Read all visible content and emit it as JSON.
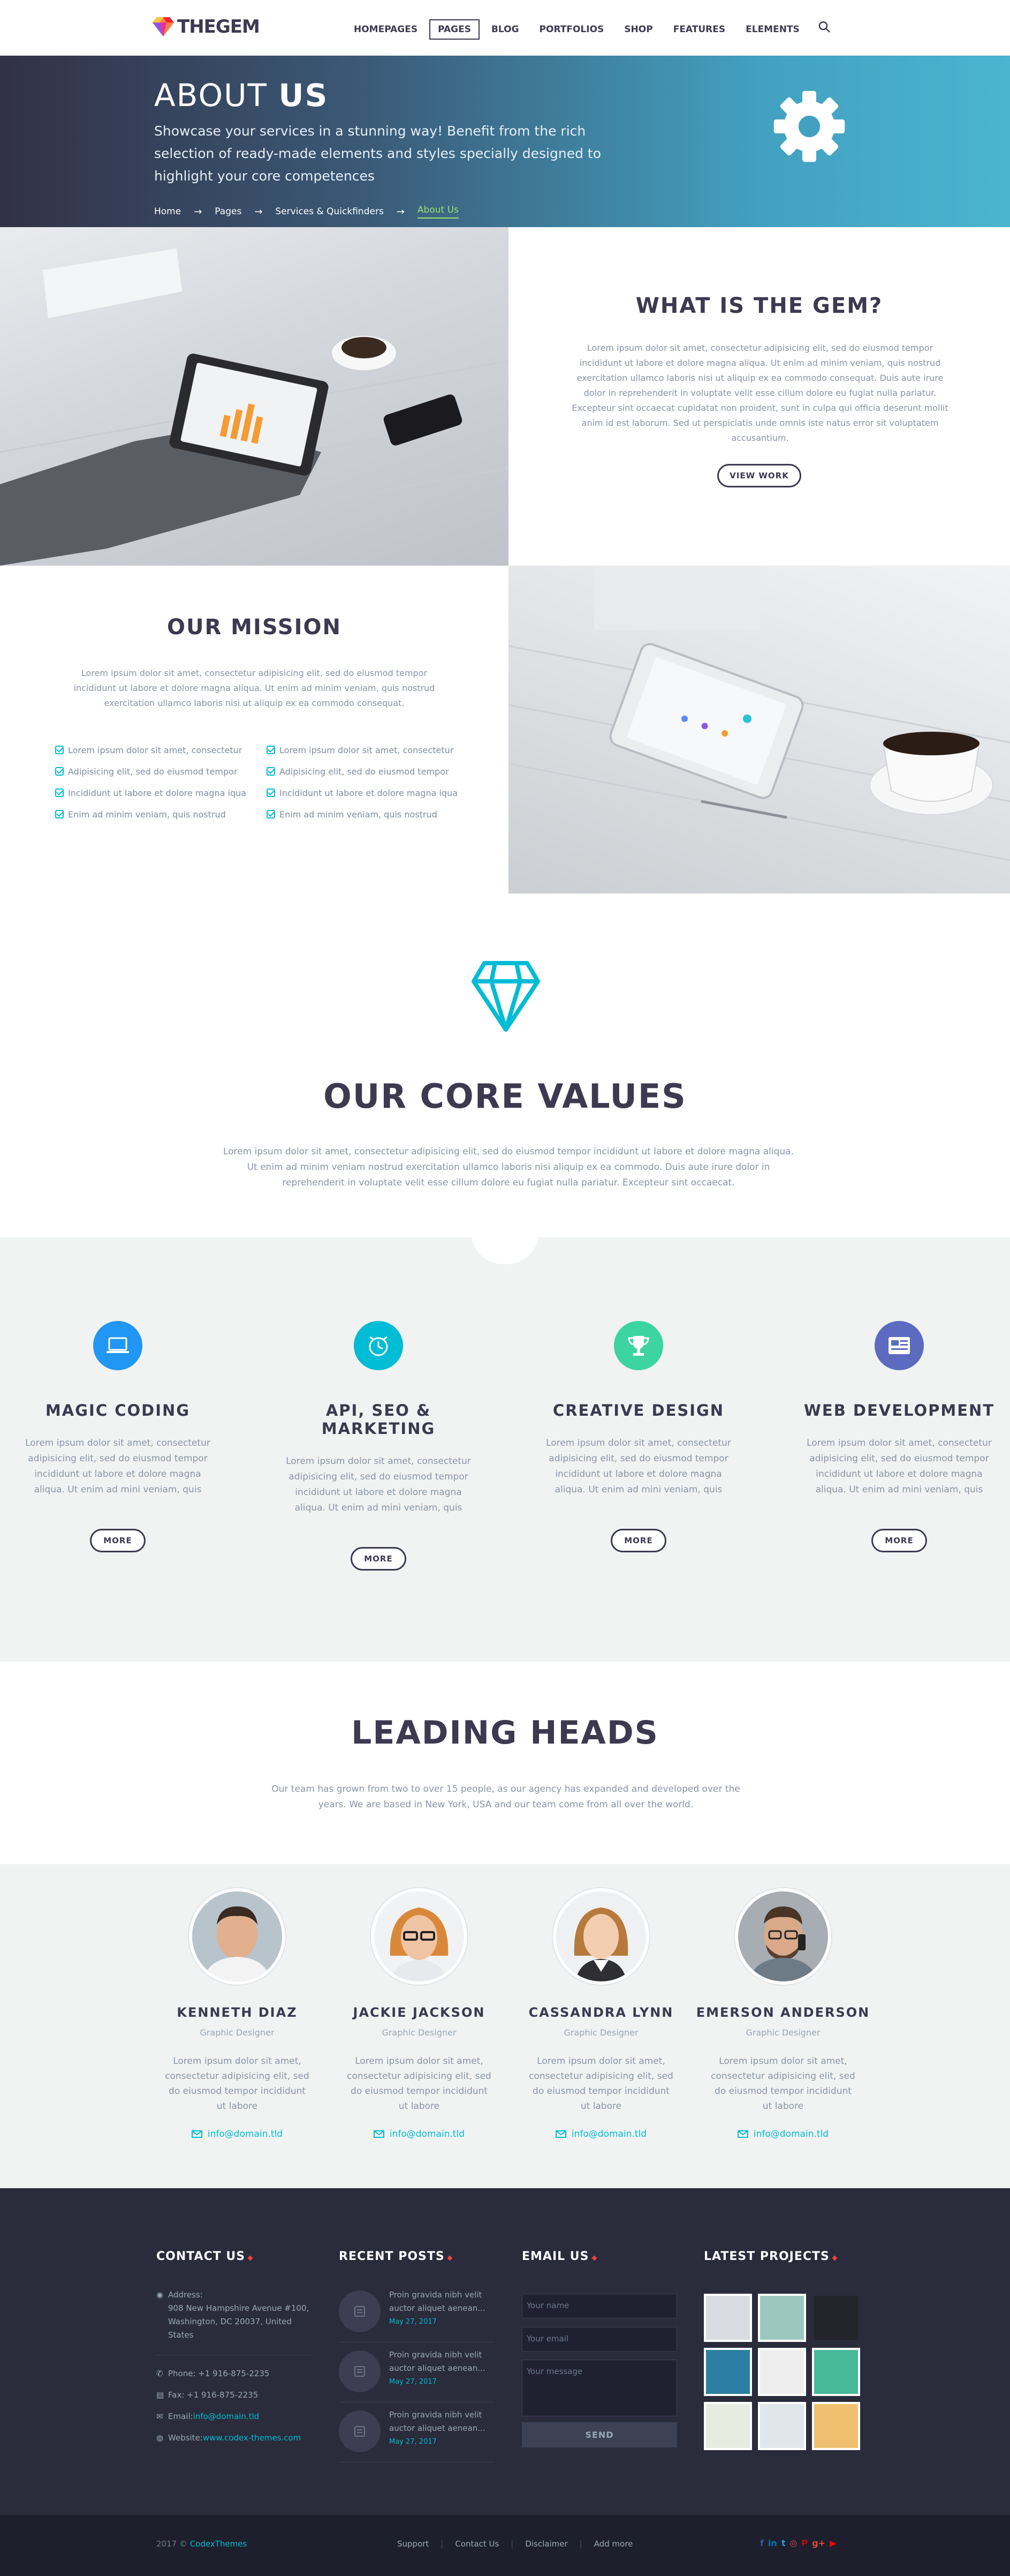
{
  "header": {
    "logo_text": "THEGEM",
    "nav": [
      "HOMEPAGES",
      "PAGES",
      "BLOG",
      "PORTFOLIOS",
      "SHOP",
      "FEATURES",
      "ELEMENTS"
    ],
    "active_nav": "PAGES"
  },
  "hero": {
    "title_light": "ABOUT",
    "title_bold": "US",
    "subtitle": "Showcase your services in a stunning way! Benefit from the rich selection of ready-made elements and styles specially designed to highlight your core competences",
    "breadcrumbs": [
      "Home",
      "Pages",
      "Services & Quickfinders",
      "About Us"
    ]
  },
  "what": {
    "title": "WHAT IS THE GEM?",
    "text": "Lorem ipsum dolor sit amet, consectetur adipisicing elit, sed do eiusmod tempor incididunt ut labore et dolore magna aliqua. Ut enim ad minim veniam, quis nostrud exercitation ullamco laboris nisi ut aliquip ex ea commodo consequat. Duis aute irure dolor in reprehenderit in voluptate velit esse cillum dolore eu fugiat nulla pariatur. Excepteur sint occaecat cupidatat non proident, sunt in culpa qui officia deserunt mollit anim id est laborum. Sed ut perspiciatis unde omnis iste natus error sit voluptatem accusantium.",
    "button": "VIEW WORK"
  },
  "mission": {
    "title": "OUR MISSION",
    "text": "Lorem ipsum dolor sit amet, consectetur adipisicing elit, sed do eiusmod tempor incididunt ut labore et dolore magna aliqua. Ut enim ad minim veniam, quis nostrud exercitation ullamco laboris nisi ut aliquip ex ea commodo consequat.",
    "list_left": [
      "Lorem ipsum dolor sit amet, consectetur",
      "Adipisicing elit, sed do eiusmod tempor",
      "Incididunt ut labore et dolore magna iqua",
      "Enim ad minim veniam, quis nostrud"
    ],
    "list_right": [
      "Lorem ipsum dolor sit amet, consectetur",
      "Adipisicing elit, sed do eiusmod tempor",
      "Incididunt ut labore et dolore magna iqua",
      "Enim ad minim veniam, quis nostrud"
    ]
  },
  "values": {
    "title": "OUR CORE VALUES",
    "text": "Lorem ipsum dolor sit amet, consectetur adipisicing elit, sed do eiusmod tempor incididunt ut labore et dolore magna aliqua. Ut enim ad minim veniam nostrud exercitation ullamco laboris nisi aliquip ex ea commodo. Duis aute irure dolor in reprehenderit in voluptate velit esse cillum dolore eu fugiat nulla pariatur. Excepteur sint occaecat.",
    "icon_color": "#00bcd4"
  },
  "services": [
    {
      "title": "MAGIC CODING",
      "icon": "laptop-icon",
      "color": "#2196f3",
      "text": "Lorem ipsum dolor sit amet, consectetur adipisicing elit, sed do eiusmod tempor incididunt ut labore et dolore magna aliqua. Ut enim ad mini veniam, quis",
      "button": "MORE"
    },
    {
      "title": "API, SEO & MARKETING",
      "icon": "clock-icon",
      "color": "#00bcd4",
      "text": "Lorem ipsum dolor sit amet, consectetur adipisicing elit, sed do eiusmod tempor incididunt ut labore et dolore magna aliqua. Ut enim ad mini veniam, quis",
      "button": "MORE"
    },
    {
      "title": "CREATIVE DESIGN",
      "icon": "trophy-icon",
      "color": "#3cd4a0",
      "text": "Lorem ipsum dolor sit amet, consectetur adipisicing elit, sed do eiusmod tempor incididunt ut labore et dolore magna aliqua. Ut enim ad mini veniam, quis",
      "button": "MORE"
    },
    {
      "title": "WEB DEVELOPMENT",
      "icon": "news-icon",
      "color": "#5c6bc0",
      "text": "Lorem ipsum dolor sit amet, consectetur adipisicing elit, sed do eiusmod tempor incididunt ut labore et dolore magna aliqua. Ut enim ad mini veniam, quis",
      "button": "MORE"
    }
  ],
  "leading": {
    "title": "LEADING HEADS",
    "text": "Our team has grown from two to over 15 people, as our agency has expanded and developed over the years. We are based in New York, USA and our team come from all over the world."
  },
  "team": [
    {
      "name": "KENNETH DIAZ",
      "role": "Graphic Designer",
      "text": "Lorem ipsum dolor sit amet, consectetur adipisicing elit, sed do eiusmod tempor incididunt ut labore",
      "email": "info@domain.tld"
    },
    {
      "name": "JACKIE JACKSON",
      "role": "Graphic Designer",
      "text": "Lorem ipsum dolor sit amet, consectetur adipisicing elit, sed do eiusmod tempor incididunt ut labore",
      "email": "info@domain.tld"
    },
    {
      "name": "CASSANDRA LYNN",
      "role": "Graphic Designer",
      "text": "Lorem ipsum dolor sit amet, consectetur adipisicing elit, sed do eiusmod tempor incididunt ut labore",
      "email": "info@domain.tld"
    },
    {
      "name": "EMERSON ANDERSON",
      "role": "Graphic Designer",
      "text": "Lorem ipsum dolor sit amet, consectetur adipisicing elit, sed do eiusmod tempor incididunt ut labore",
      "email": "info@domain.tld"
    }
  ],
  "footer": {
    "contact_title": "CONTACT US",
    "address_label": "Address:",
    "address": "908 New Hampshire Avenue #100, Washington, DC 20037, United States",
    "phone": "Phone: +1 916-875-2235",
    "fax": "Fax: +1 916-875-2235",
    "email_label": "Email: ",
    "email": "info@domain.tld",
    "website_label": "Website: ",
    "website": "www.codex-themes.com",
    "posts_title": "RECENT POSTS",
    "posts": [
      {
        "title": "Proin gravida nibh velit auctor aliquet aenean...",
        "date": "May 27, 2017"
      },
      {
        "title": "Proin gravida nibh velit auctor aliquet aenean...",
        "date": "May 27, 2017"
      },
      {
        "title": "Proin gravida nibh velit auctor aliquet aenean...",
        "date": "May 27, 2017"
      }
    ],
    "email_us_title": "EMAIL US",
    "name_placeholder": "Your name",
    "email_placeholder": "Your email",
    "message_placeholder": "Your message",
    "send": "SEND",
    "projects_title": "LATEST PROJECTS",
    "project_colors": [
      "#d9dde2",
      "#9bc7c0",
      "#23232a",
      "#2c7fa3",
      "#eeeeee",
      "#48b89a",
      "#e8ece0",
      "#dfe6ec",
      "#f0c070"
    ]
  },
  "bottom": {
    "copyright": "2017 © ",
    "brand": "CodexThemes",
    "links": [
      "Support",
      "Contact Us",
      "Disclaimer",
      "Add more"
    ],
    "social_colors": [
      "#3b5998",
      "#0077b5",
      "#1da1f2",
      "#e4405f",
      "#bd081c",
      "#dd4b39",
      "#ff0000"
    ]
  }
}
